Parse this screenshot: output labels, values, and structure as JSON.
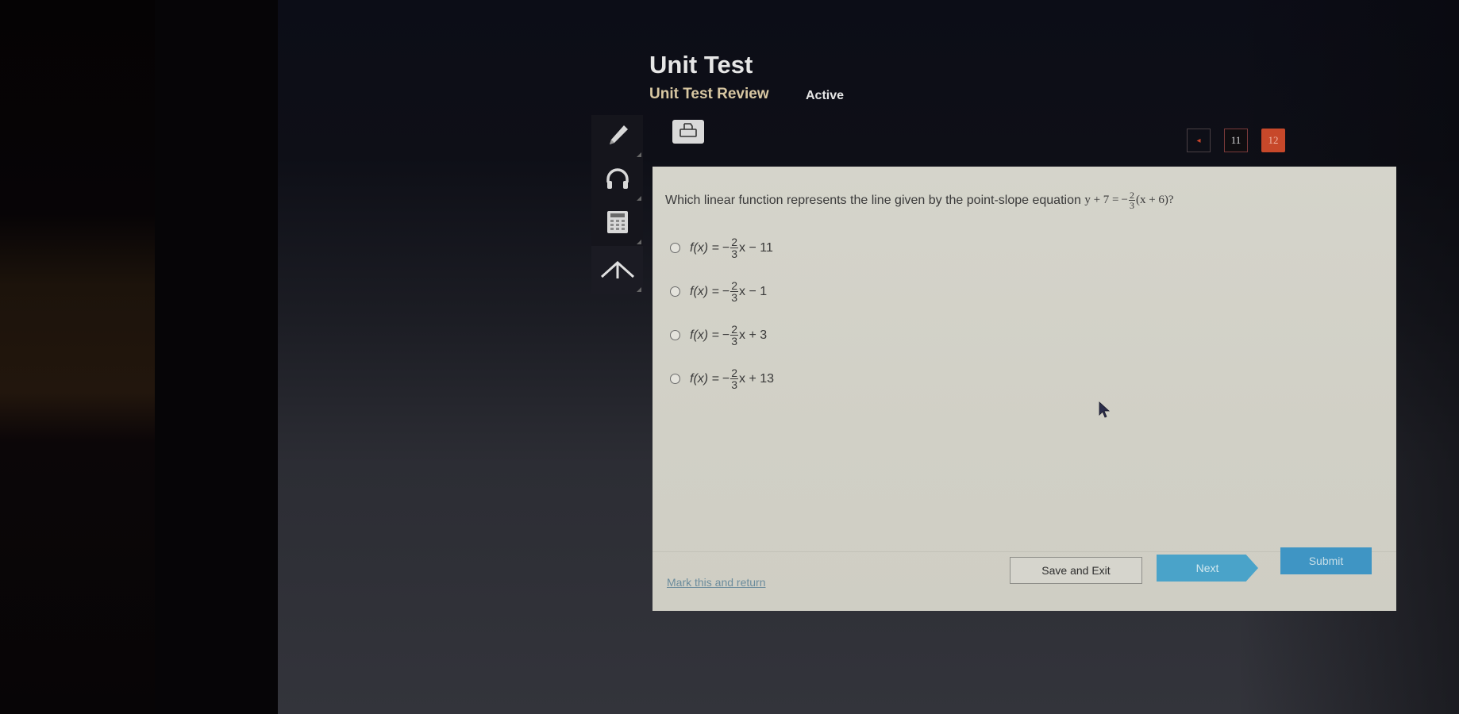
{
  "header": {
    "title": "Unit Test",
    "subtitle": "Unit Test Review",
    "status": "Active"
  },
  "toolbar": {
    "tools": [
      {
        "name": "pencil",
        "icon": "pencil-icon"
      },
      {
        "name": "audio",
        "icon": "headphones-icon"
      },
      {
        "name": "calculator",
        "icon": "calculator-icon"
      },
      {
        "name": "reference",
        "icon": "formula-arrow-icon"
      }
    ],
    "print": {
      "icon": "printer-icon"
    }
  },
  "pagination": {
    "prev_icon": "◂",
    "pages": [
      "11",
      "12"
    ],
    "current": "12"
  },
  "question": {
    "text": "Which linear function represents the line given by the point-slope equation",
    "equation": {
      "lhs": "y + 7 =",
      "sign": "−",
      "frac_num": "2",
      "frac_den": "3",
      "rhs": "(x + 6)?"
    }
  },
  "choices": [
    {
      "prefix": "f(x) =",
      "sign": "−",
      "num": "2",
      "den": "3",
      "suffix": "x − 11",
      "selected": false
    },
    {
      "prefix": "f(x) =",
      "sign": "−",
      "num": "2",
      "den": "3",
      "suffix": "x − 1",
      "selected": false
    },
    {
      "prefix": "f(x) =",
      "sign": "−",
      "num": "2",
      "den": "3",
      "suffix": "x + 3",
      "selected": false
    },
    {
      "prefix": "f(x) =",
      "sign": "−",
      "num": "2",
      "den": "3",
      "suffix": "x + 13",
      "selected": false
    }
  ],
  "footer": {
    "mark_label": "Mark this and return",
    "save_label": "Save and Exit",
    "next_label": "Next",
    "submit_label": "Submit"
  },
  "colors": {
    "accent_orange": "#c7482a",
    "button_blue": "#4aa3c9",
    "subtitle_tan": "#d8c7a2"
  }
}
